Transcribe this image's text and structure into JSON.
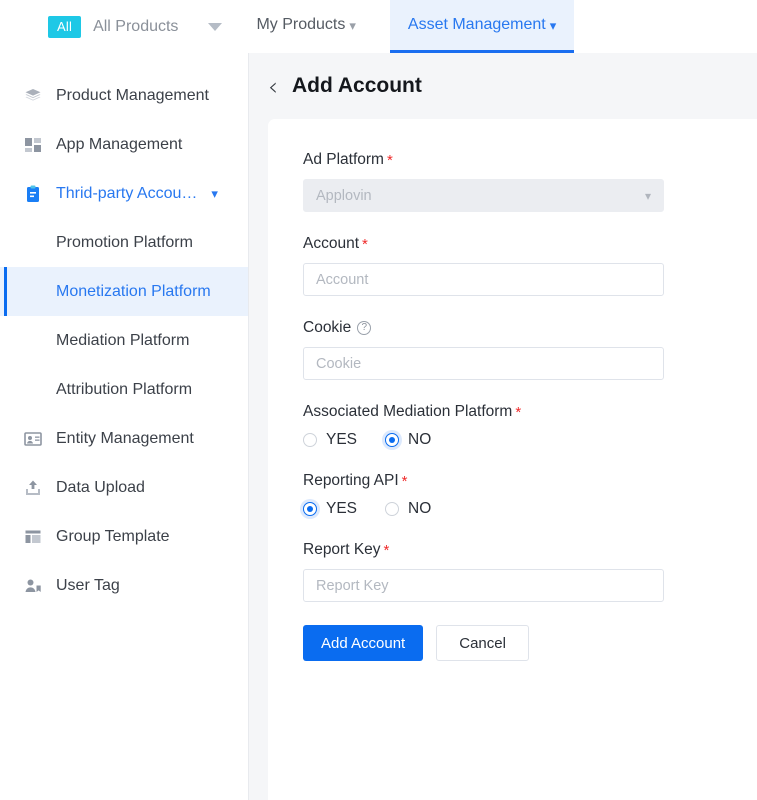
{
  "topbar": {
    "all_badge": "All",
    "all_products_label": "All Products",
    "dropdown_icon": "caret-down-icon",
    "tabs": [
      {
        "label": "My Products",
        "icon": "chevron-down-icon",
        "active": false
      },
      {
        "label": "Asset Management",
        "icon": "chevron-down-icon",
        "active": true
      }
    ]
  },
  "sidebar": {
    "items": [
      {
        "label": "Product Management",
        "icon": "layers-icon",
        "type": "top"
      },
      {
        "label": "App Management",
        "icon": "app-grid-icon",
        "type": "top"
      },
      {
        "label": "Thrid-party Accou…",
        "icon": "clipboard-icon",
        "type": "expandable",
        "chevron": "chevron-down-icon"
      },
      {
        "label": "Promotion Platform",
        "icon": "",
        "type": "sub"
      },
      {
        "label": "Monetization Platform",
        "icon": "",
        "type": "sub-selected"
      },
      {
        "label": "Mediation Platform",
        "icon": "",
        "type": "sub"
      },
      {
        "label": "Attribution Platform",
        "icon": "",
        "type": "sub"
      },
      {
        "label": "Entity Management",
        "icon": "contact-card-icon",
        "type": "top"
      },
      {
        "label": "Data Upload",
        "icon": "upload-icon",
        "type": "top"
      },
      {
        "label": "Group Template",
        "icon": "template-layout-icon",
        "type": "top"
      },
      {
        "label": "User Tag",
        "icon": "user-tag-icon",
        "type": "top"
      }
    ]
  },
  "page": {
    "back_icon": "back-chevron-icon",
    "title": "Add Account"
  },
  "form": {
    "ad_platform": {
      "label": "Ad Platform",
      "required_mark": "*",
      "value": "Applovin",
      "disabled": true,
      "chevron": "chevron-down-icon"
    },
    "account": {
      "label": "Account",
      "required_mark": "*",
      "placeholder": "Account",
      "value": ""
    },
    "cookie": {
      "label": "Cookie",
      "help_icon": "question-mark-circle-icon",
      "placeholder": "Cookie",
      "value": ""
    },
    "associated_mediation_platform": {
      "label": "Associated Mediation Platform",
      "required_mark": "*",
      "options": [
        {
          "label": "YES",
          "checked": false
        },
        {
          "label": "NO",
          "checked": true
        }
      ]
    },
    "reporting_api": {
      "label": "Reporting API",
      "required_mark": "*",
      "options": [
        {
          "label": "YES",
          "checked": true
        },
        {
          "label": "NO",
          "checked": false
        }
      ]
    },
    "report_key": {
      "label": "Report Key",
      "required_mark": "*",
      "placeholder": "Report Key",
      "value": ""
    },
    "submit_label": "Add Account",
    "cancel_label": "Cancel"
  },
  "colors": {
    "accent_blue": "#0a6cf0",
    "link_blue": "#2878f0",
    "badge_cyan": "#1ec8e6",
    "required_red": "#ef2a2a",
    "panel_grey": "#f5f6f8",
    "selected_bg": "#eaf2fd"
  }
}
